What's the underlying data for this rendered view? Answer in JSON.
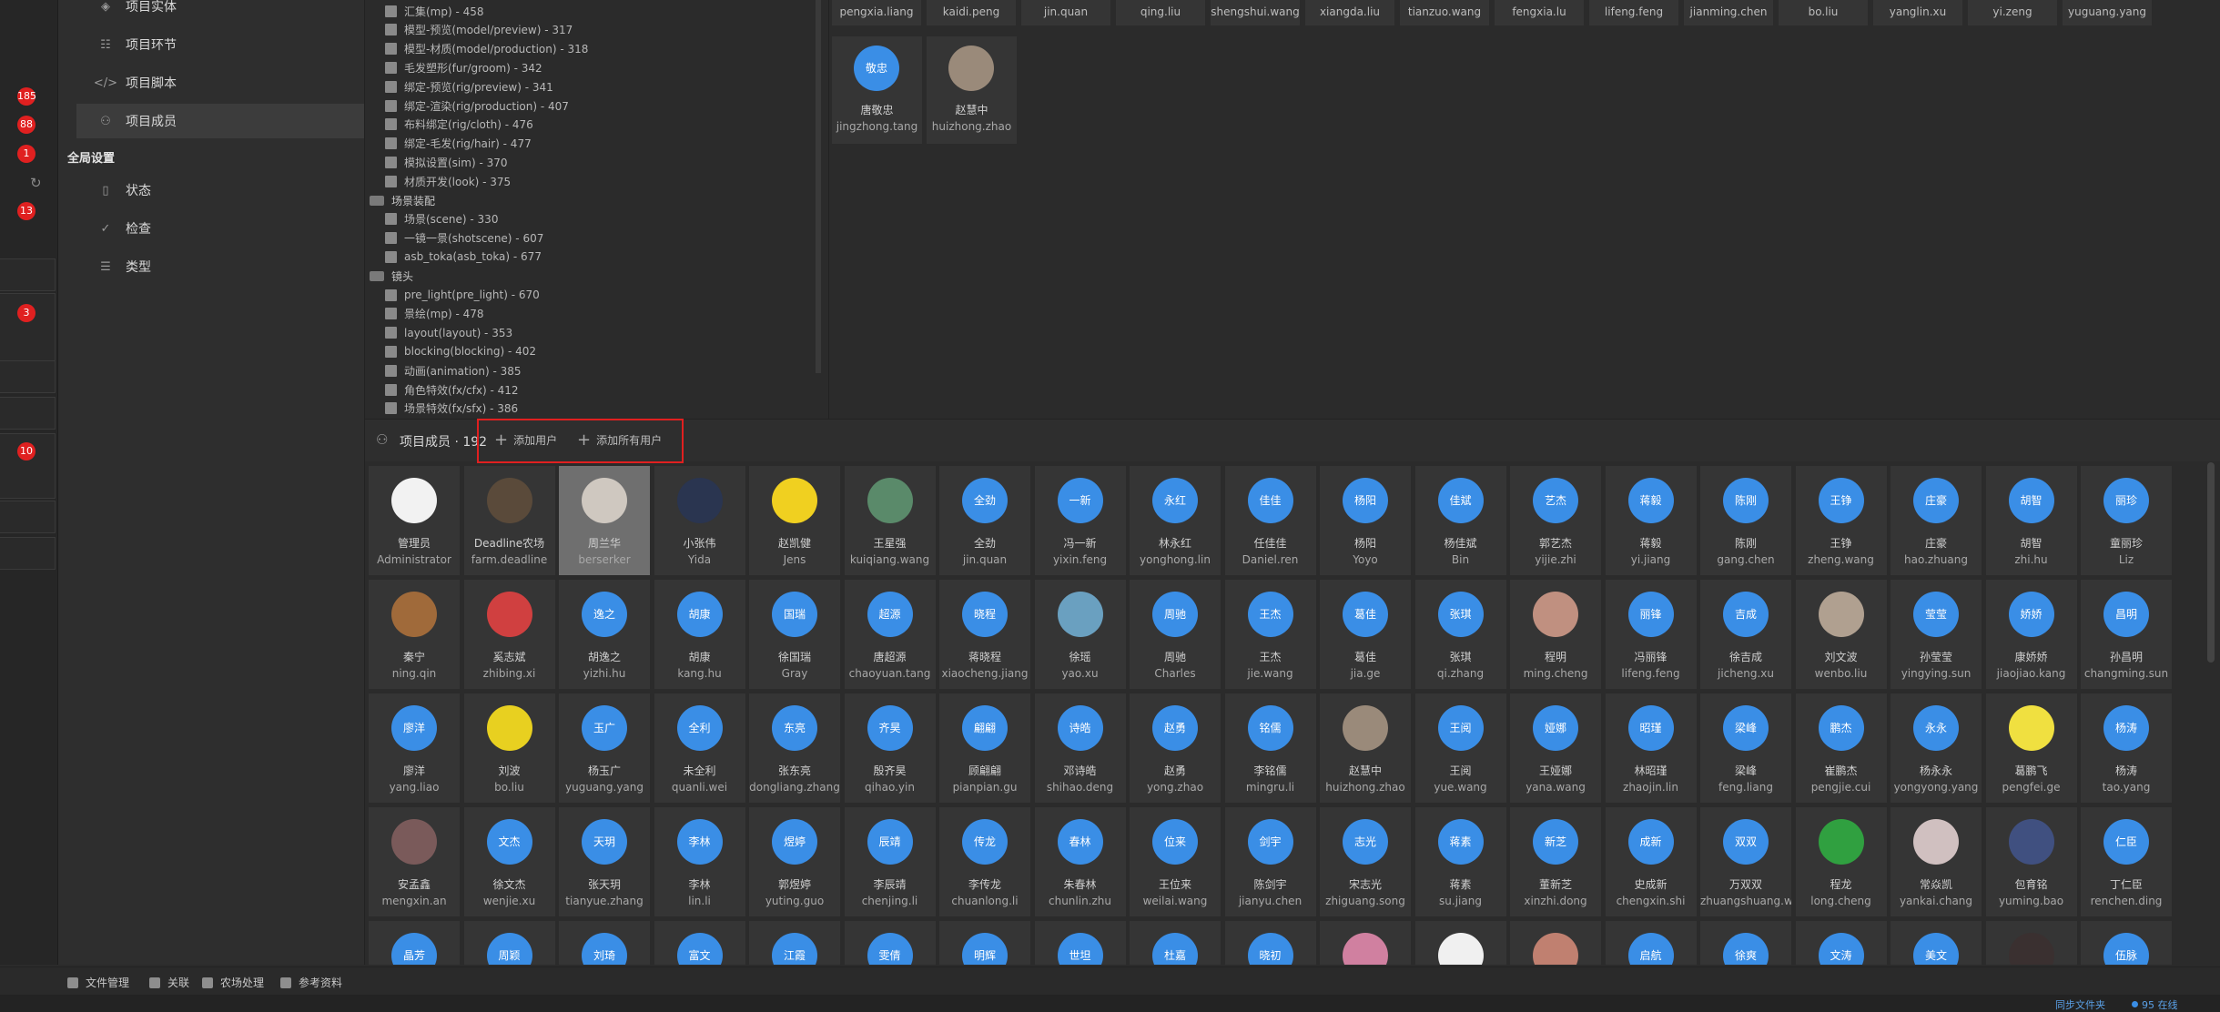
{
  "rail": {
    "badges": [
      "185",
      "88",
      "1",
      "13",
      "3",
      "10"
    ]
  },
  "nav": {
    "items": [
      {
        "label": "项目实体",
        "icon": "entity-icon"
      },
      {
        "label": "项目环节",
        "icon": "step-icon"
      },
      {
        "label": "项目脚本",
        "icon": "code-icon"
      },
      {
        "label": "项目成员",
        "icon": "members-icon"
      }
    ],
    "global_section": "全局设置",
    "global_items": [
      {
        "label": "状态",
        "icon": "status-icon"
      },
      {
        "label": "检查",
        "icon": "check-icon"
      },
      {
        "label": "类型",
        "icon": "type-icon"
      }
    ]
  },
  "tree": {
    "rows": [
      "汇集(mp) - 458",
      "模型-预览(model/preview) - 317",
      "模型-材质(model/production) - 318",
      "毛发塑形(fur/groom) - 342",
      "绑定-预览(rig/preview) - 341",
      "绑定-渲染(rig/production) - 407",
      "布料绑定(rig/cloth) - 476",
      "绑定-毛发(rig/hair) - 477",
      "模拟设置(sim) - 370",
      "材质开发(look) - 375"
    ],
    "group_scene": "场景装配",
    "scene_rows": [
      "场景(scene) - 330",
      "一镜一景(shotscene) - 607",
      "asb_toka(asb_toka) - 677"
    ],
    "group_shot": "镜头",
    "shot_rows": [
      "pre_light(pre_light) - 670",
      "景绘(mp) - 478",
      "layout(layout) - 353",
      "blocking(blocking) - 402",
      "动画(animation) - 385",
      "角色特效(fx/cfx) - 412",
      "场景特效(fx/sfx) - 386"
    ]
  },
  "top_grid": {
    "partial_logins": [
      "pengxia.liang",
      "kaidi.peng",
      "jin.quan",
      "qing.liu",
      "shengshui.wang",
      "xiangda.liu",
      "tianzuo.wang",
      "fengxia.lu",
      "lifeng.feng",
      "jianming.chen",
      "bo.liu",
      "yanglin.xu",
      "yi.zeng",
      "yuguang.yang"
    ],
    "users": [
      {
        "avatar": "敬忠",
        "name": "唐敬忠",
        "login": "jingzhong.tang",
        "img": false
      },
      {
        "avatar": "",
        "name": "赵慧中",
        "login": "huizhong.zhao",
        "img": true
      }
    ]
  },
  "members": {
    "title": "项目成员 · 192",
    "add_user": "添加用户",
    "add_all_users": "添加所有用户",
    "rows": [
      [
        {
          "a": "",
          "n": "管理员",
          "l": "Administrator",
          "img": "#f2f2f2"
        },
        {
          "a": "",
          "n": "Deadline农场",
          "l": "farm.deadline",
          "img": "#5a4a3a"
        },
        {
          "a": "",
          "n": "周兰华",
          "l": "berserker",
          "img": "#cfc8c0",
          "sel": true
        },
        {
          "a": "",
          "n": "小张伟",
          "l": "Yida",
          "img": "#2a3550"
        },
        {
          "a": "",
          "n": "赵凯健",
          "l": "Jens",
          "img": "#f0d020"
        },
        {
          "a": "",
          "n": "王星强",
          "l": "kuiqiang.wang",
          "img": "#5a8a6a"
        },
        {
          "a": "全劲",
          "n": "全劲",
          "l": "jin.quan"
        },
        {
          "a": "一新",
          "n": "冯一新",
          "l": "yixin.feng"
        },
        {
          "a": "永红",
          "n": "林永红",
          "l": "yonghong.lin"
        },
        {
          "a": "佳佳",
          "n": "任佳佳",
          "l": "Daniel.ren"
        },
        {
          "a": "杨阳",
          "n": "杨阳",
          "l": "Yoyo"
        },
        {
          "a": "佳斌",
          "n": "杨佳斌",
          "l": "Bin"
        },
        {
          "a": "艺杰",
          "n": "郭艺杰",
          "l": "yijie.zhi"
        },
        {
          "a": "蒋毅",
          "n": "蒋毅",
          "l": "yi.jiang"
        },
        {
          "a": "陈刚",
          "n": "陈刚",
          "l": "gang.chen"
        },
        {
          "a": "王铮",
          "n": "王铮",
          "l": "zheng.wang"
        },
        {
          "a": "庄豪",
          "n": "庄豪",
          "l": "hao.zhuang"
        },
        {
          "a": "胡智",
          "n": "胡智",
          "l": "zhi.hu"
        },
        {
          "a": "丽珍",
          "n": "童丽珍",
          "l": "Liz"
        }
      ],
      [
        {
          "a": "",
          "n": "秦宁",
          "l": "ning.qin",
          "img": "#a06a3a"
        },
        {
          "a": "",
          "n": "奚志斌",
          "l": "zhibing.xi",
          "img": "#d04040"
        },
        {
          "a": "逸之",
          "n": "胡逸之",
          "l": "yizhi.hu"
        },
        {
          "a": "胡康",
          "n": "胡康",
          "l": "kang.hu"
        },
        {
          "a": "国瑞",
          "n": "徐国瑞",
          "l": "Gray"
        },
        {
          "a": "超源",
          "n": "唐超源",
          "l": "chaoyuan.tang"
        },
        {
          "a": "晓程",
          "n": "蒋晓程",
          "l": "xiaocheng.jiang"
        },
        {
          "a": "",
          "n": "徐瑶",
          "l": "yao.xu",
          "img": "#6aa0c0"
        },
        {
          "a": "周驰",
          "n": "周驰",
          "l": "Charles"
        },
        {
          "a": "王杰",
          "n": "王杰",
          "l": "jie.wang"
        },
        {
          "a": "葛佳",
          "n": "葛佳",
          "l": "jia.ge"
        },
        {
          "a": "张琪",
          "n": "张琪",
          "l": "qi.zhang"
        },
        {
          "a": "",
          "n": "程明",
          "l": "ming.cheng",
          "img": "#c09080"
        },
        {
          "a": "丽锋",
          "n": "冯丽锋",
          "l": "lifeng.feng"
        },
        {
          "a": "吉成",
          "n": "徐吉成",
          "l": "jicheng.xu"
        },
        {
          "a": "",
          "n": "刘文波",
          "l": "wenbo.liu",
          "img": "#b0a090"
        },
        {
          "a": "莹莹",
          "n": "孙莹莹",
          "l": "yingying.sun"
        },
        {
          "a": "娇娇",
          "n": "康娇娇",
          "l": "jiaojiao.kang"
        },
        {
          "a": "昌明",
          "n": "孙昌明",
          "l": "changming.sun"
        }
      ],
      [
        {
          "a": "廖洋",
          "n": "廖洋",
          "l": "yang.liao"
        },
        {
          "a": "",
          "n": "刘波",
          "l": "bo.liu",
          "img": "#e8d020"
        },
        {
          "a": "玉广",
          "n": "杨玉广",
          "l": "yuguang.yang"
        },
        {
          "a": "全利",
          "n": "未全利",
          "l": "quanli.wei"
        },
        {
          "a": "东亮",
          "n": "张东亮",
          "l": "dongliang.zhang"
        },
        {
          "a": "齐昊",
          "n": "殷齐昊",
          "l": "qihao.yin"
        },
        {
          "a": "翩翩",
          "n": "顾翩翩",
          "l": "pianpian.gu"
        },
        {
          "a": "诗皓",
          "n": "邓诗皓",
          "l": "shihao.deng"
        },
        {
          "a": "赵勇",
          "n": "赵勇",
          "l": "yong.zhao"
        },
        {
          "a": "铭儒",
          "n": "李铭儒",
          "l": "mingru.li"
        },
        {
          "a": "",
          "n": "赵慧中",
          "l": "huizhong.zhao",
          "img": "#9a8a7a"
        },
        {
          "a": "王阅",
          "n": "王阅",
          "l": "yue.wang"
        },
        {
          "a": "娅娜",
          "n": "王娅娜",
          "l": "yana.wang"
        },
        {
          "a": "昭瑾",
          "n": "林昭瑾",
          "l": "zhaojin.lin"
        },
        {
          "a": "梁峰",
          "n": "梁峰",
          "l": "feng.liang"
        },
        {
          "a": "鹏杰",
          "n": "崔鹏杰",
          "l": "pengjie.cui"
        },
        {
          "a": "永永",
          "n": "杨永永",
          "l": "yongyong.yang"
        },
        {
          "a": "",
          "n": "葛鹏飞",
          "l": "pengfei.ge",
          "img": "#f0e040"
        },
        {
          "a": "杨涛",
          "n": "杨涛",
          "l": "tao.yang"
        }
      ],
      [
        {
          "a": "",
          "n": "安孟鑫",
          "l": "mengxin.an",
          "img": "#7a5a5a"
        },
        {
          "a": "文杰",
          "n": "徐文杰",
          "l": "wenjie.xu"
        },
        {
          "a": "天玥",
          "n": "张天玥",
          "l": "tianyue.zhang"
        },
        {
          "a": "李林",
          "n": "李林",
          "l": "lin.li"
        },
        {
          "a": "煜婷",
          "n": "郭煜婷",
          "l": "yuting.guo"
        },
        {
          "a": "辰靖",
          "n": "李辰靖",
          "l": "chenjing.li"
        },
        {
          "a": "传龙",
          "n": "李传龙",
          "l": "chuanlong.li"
        },
        {
          "a": "春林",
          "n": "朱春林",
          "l": "chunlin.zhu"
        },
        {
          "a": "位来",
          "n": "王位来",
          "l": "weilai.wang"
        },
        {
          "a": "剑宇",
          "n": "陈剑宇",
          "l": "jianyu.chen"
        },
        {
          "a": "志光",
          "n": "宋志光",
          "l": "zhiguang.song"
        },
        {
          "a": "蒋素",
          "n": "蒋素",
          "l": "su.jiang"
        },
        {
          "a": "新芝",
          "n": "董新芝",
          "l": "xinzhi.dong"
        },
        {
          "a": "成新",
          "n": "史成新",
          "l": "chengxin.shi"
        },
        {
          "a": "双双",
          "n": "万双双",
          "l": "zhuangshuang.wan"
        },
        {
          "a": "",
          "n": "程龙",
          "l": "long.cheng",
          "img": "#30a040"
        },
        {
          "a": "",
          "n": "常焱凯",
          "l": "yankai.chang",
          "img": "#d0c0c0"
        },
        {
          "a": "",
          "n": "包育铭",
          "l": "yuming.bao",
          "img": "#405080"
        },
        {
          "a": "仁臣",
          "n": "丁仁臣",
          "l": "renchen.ding"
        }
      ],
      [
        {
          "a": "晶芳",
          "n": "",
          "l": ""
        },
        {
          "a": "周颖",
          "n": "",
          "l": ""
        },
        {
          "a": "刘琦",
          "n": "",
          "l": ""
        },
        {
          "a": "富文",
          "n": "",
          "l": ""
        },
        {
          "a": "江霞",
          "n": "",
          "l": ""
        },
        {
          "a": "雯倩",
          "n": "",
          "l": ""
        },
        {
          "a": "明辉",
          "n": "",
          "l": ""
        },
        {
          "a": "世坦",
          "n": "",
          "l": ""
        },
        {
          "a": "杜嘉",
          "n": "",
          "l": ""
        },
        {
          "a": "晓初",
          "n": "",
          "l": ""
        },
        {
          "a": "",
          "n": "",
          "l": "",
          "img": "#d080a0"
        },
        {
          "a": "",
          "n": "",
          "l": "",
          "img": "#f0f0f0"
        },
        {
          "a": "",
          "n": "",
          "l": "",
          "img": "#c08070"
        },
        {
          "a": "启航",
          "n": "",
          "l": ""
        },
        {
          "a": "徐爽",
          "n": "",
          "l": ""
        },
        {
          "a": "文涛",
          "n": "",
          "l": ""
        },
        {
          "a": "美文",
          "n": "",
          "l": ""
        },
        {
          "a": "",
          "n": "",
          "l": "",
          "img": "#3a3030"
        },
        {
          "a": "伍脉",
          "n": "",
          "l": ""
        }
      ]
    ]
  },
  "bottom_bar": {
    "items": [
      "文件管理",
      "关联",
      "农场处理",
      "参考资料"
    ]
  },
  "status_bar": {
    "left_text": "同步文件夹",
    "right_text": "95 在线"
  },
  "colors": {
    "accent": "#3a8ee6",
    "badge": "#e02020",
    "highlight_box": "#e02020"
  }
}
